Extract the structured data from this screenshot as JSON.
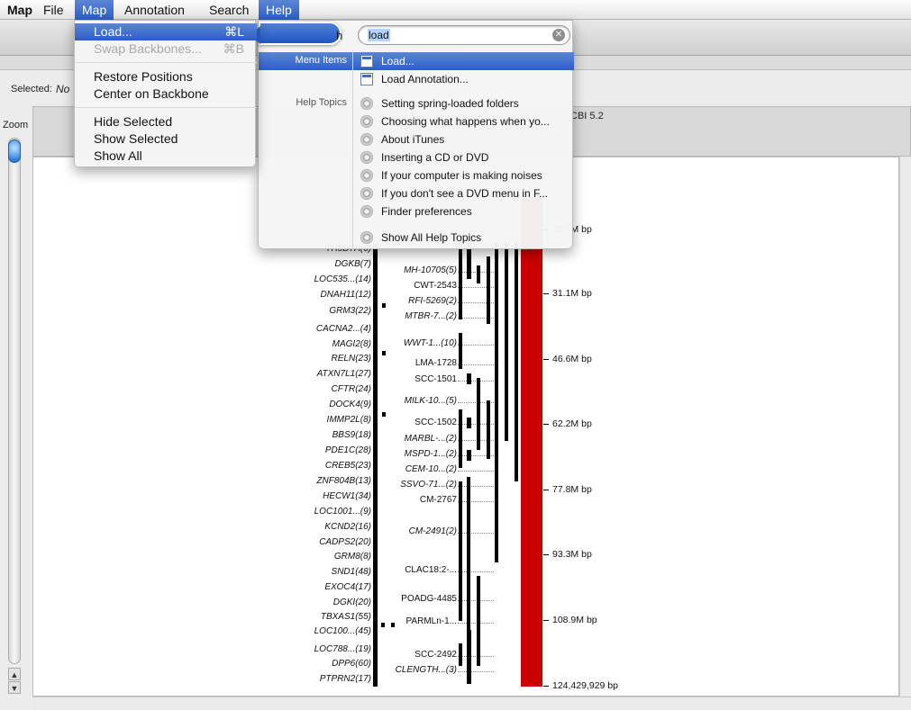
{
  "menubar": {
    "app": "Map",
    "items": [
      "File",
      "Map",
      "Annotation",
      "Search",
      "Help"
    ]
  },
  "selection": {
    "label": "Selected:",
    "value": "No"
  },
  "zoom": {
    "label": "Zoom",
    "up": "▲",
    "down": "▼"
  },
  "map_header": {
    "title_fragment": "CBI 5.2"
  },
  "map_menu": {
    "items": [
      {
        "label": "Load...",
        "shortcut": "⌘L",
        "state": "highlighted"
      },
      {
        "label": "Swap Backbones...",
        "shortcut": "⌘B",
        "state": "disabled"
      },
      {
        "label": "Restore Positions",
        "shortcut": "",
        "state": "normal"
      },
      {
        "label": "Center on Backbone",
        "shortcut": "",
        "state": "normal"
      },
      {
        "label": "Hide Selected",
        "shortcut": "",
        "state": "normal"
      },
      {
        "label": "Show Selected",
        "shortcut": "",
        "state": "normal"
      },
      {
        "label": "Show All",
        "shortcut": "",
        "state": "normal"
      }
    ]
  },
  "help_panel": {
    "search_label": "h",
    "search_value": "load",
    "clear_icon": "clear-search-icon",
    "categories": {
      "menu_items": "Menu Items",
      "help_topics": "Help Topics"
    },
    "menu_results": [
      "Load...",
      "Load Annotation..."
    ],
    "help_results": [
      "Setting spring-loaded folders",
      "Choosing what happens when yo...",
      "About iTunes",
      "Inserting a CD or DVD",
      "If your computer is making noises",
      "If you don't see a DVD menu in F...",
      "Finder preferences"
    ],
    "show_all": "Show All Help Topics"
  },
  "map": {
    "genes": [
      "TH5D7A(6)",
      "DGKB(7)",
      "LOC535...(14)",
      "DNAH11(12)",
      "GRM3(22)",
      "CACNA2...(4)",
      "MAGI2(8)",
      "RELN(23)",
      "ATXN7L1(27)",
      "CFTR(24)",
      "DOCK4(9)",
      "IMMP2L(8)",
      "BBS9(18)",
      "PDE1C(28)",
      "CREB5(23)",
      "ZNF804B(13)",
      "HECW1(34)",
      "LOC1001...(9)",
      "KCND2(16)",
      "CADPS2(20)",
      "GRM8(8)",
      "SND1(48)",
      "EXOC4(17)",
      "DGKI(20)",
      "TBXAS1(55)",
      "LOC100...(45)",
      "LOC788...(19)",
      "DPP6(60)",
      "PTPRN2(17)"
    ],
    "contigs": [
      {
        "label": "MH-10705(5)",
        "italic": true
      },
      {
        "label": "CWT-2543",
        "italic": false
      },
      {
        "label": "RFI-5269(2)",
        "italic": true
      },
      {
        "label": "MTBR-7...(2)",
        "italic": true
      },
      {
        "label": "WWT-1...(10)",
        "italic": true
      },
      {
        "label": "LMA-1728",
        "italic": false
      },
      {
        "label": "SCC-1501",
        "italic": false
      },
      {
        "label": "MILK-10...(5)",
        "italic": true
      },
      {
        "label": "SCC-1502",
        "italic": false
      },
      {
        "label": "MARBL-...(2)",
        "italic": true
      },
      {
        "label": "MSPD-1...(2)",
        "italic": true
      },
      {
        "label": "CEM-10...(2)",
        "italic": true
      },
      {
        "label": "SSVO-71...(2)",
        "italic": true
      },
      {
        "label": "CM-2767",
        "italic": false
      },
      {
        "label": "CM-2491(2)",
        "italic": true
      },
      {
        "label": "CLAC18:2-...",
        "italic": false
      },
      {
        "label": "POADG-4485",
        "italic": false
      },
      {
        "label": "PARMLn-1...",
        "italic": false
      },
      {
        "label": "SCC-2492",
        "italic": false
      },
      {
        "label": "CLENGTH...(3)",
        "italic": true
      }
    ],
    "axis": [
      "15.7M bp",
      "31.1M bp",
      "46.6M bp",
      "62.2M bp",
      "77.8M bp",
      "93.3M bp",
      "108.9M bp",
      "124,429,929 bp"
    ],
    "backbone_color": "#cc0000"
  }
}
